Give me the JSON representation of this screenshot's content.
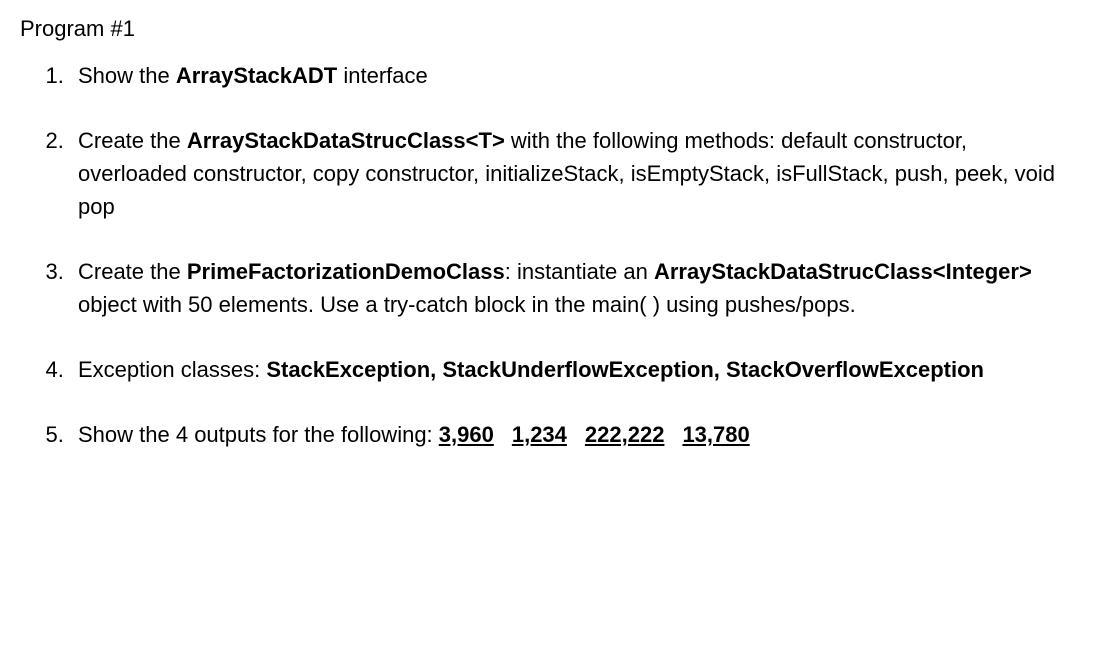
{
  "title": "Program #1",
  "items": [
    {
      "parts": [
        {
          "text": "Show the ",
          "bold": false
        },
        {
          "text": "ArrayStackADT",
          "bold": true
        },
        {
          "text": " interface",
          "bold": false
        }
      ]
    },
    {
      "parts": [
        {
          "text": "Create the ",
          "bold": false
        },
        {
          "text": "ArrayStackDataStrucClass<T>",
          "bold": true
        },
        {
          "text": " with the following methods: default constructor, overloaded constructor, copy constructor, initializeStack, isEmptyStack, isFullStack, push, peek, void pop",
          "bold": false
        }
      ]
    },
    {
      "parts": [
        {
          "text": "Create the ",
          "bold": false
        },
        {
          "text": "PrimeFactorizationDemoClass",
          "bold": true
        },
        {
          "text": ": instantiate an ",
          "bold": false
        },
        {
          "text": "ArrayStackDataStrucClass<Integer>",
          "bold": true
        },
        {
          "text": " object with 50 elements. Use a try-catch block in the main( ) using pushes/pops.",
          "bold": false
        }
      ]
    },
    {
      "parts": [
        {
          "text": "Exception classes: ",
          "bold": false
        },
        {
          "text": "StackException, StackUnderflowException, StackOverflowException",
          "bold": true
        }
      ]
    },
    {
      "parts": [
        {
          "text": "Show the 4 outputs for the following: ",
          "bold": false
        }
      ],
      "numbers": [
        "3,960",
        "1,234",
        "222,222",
        "13,780"
      ]
    }
  ]
}
